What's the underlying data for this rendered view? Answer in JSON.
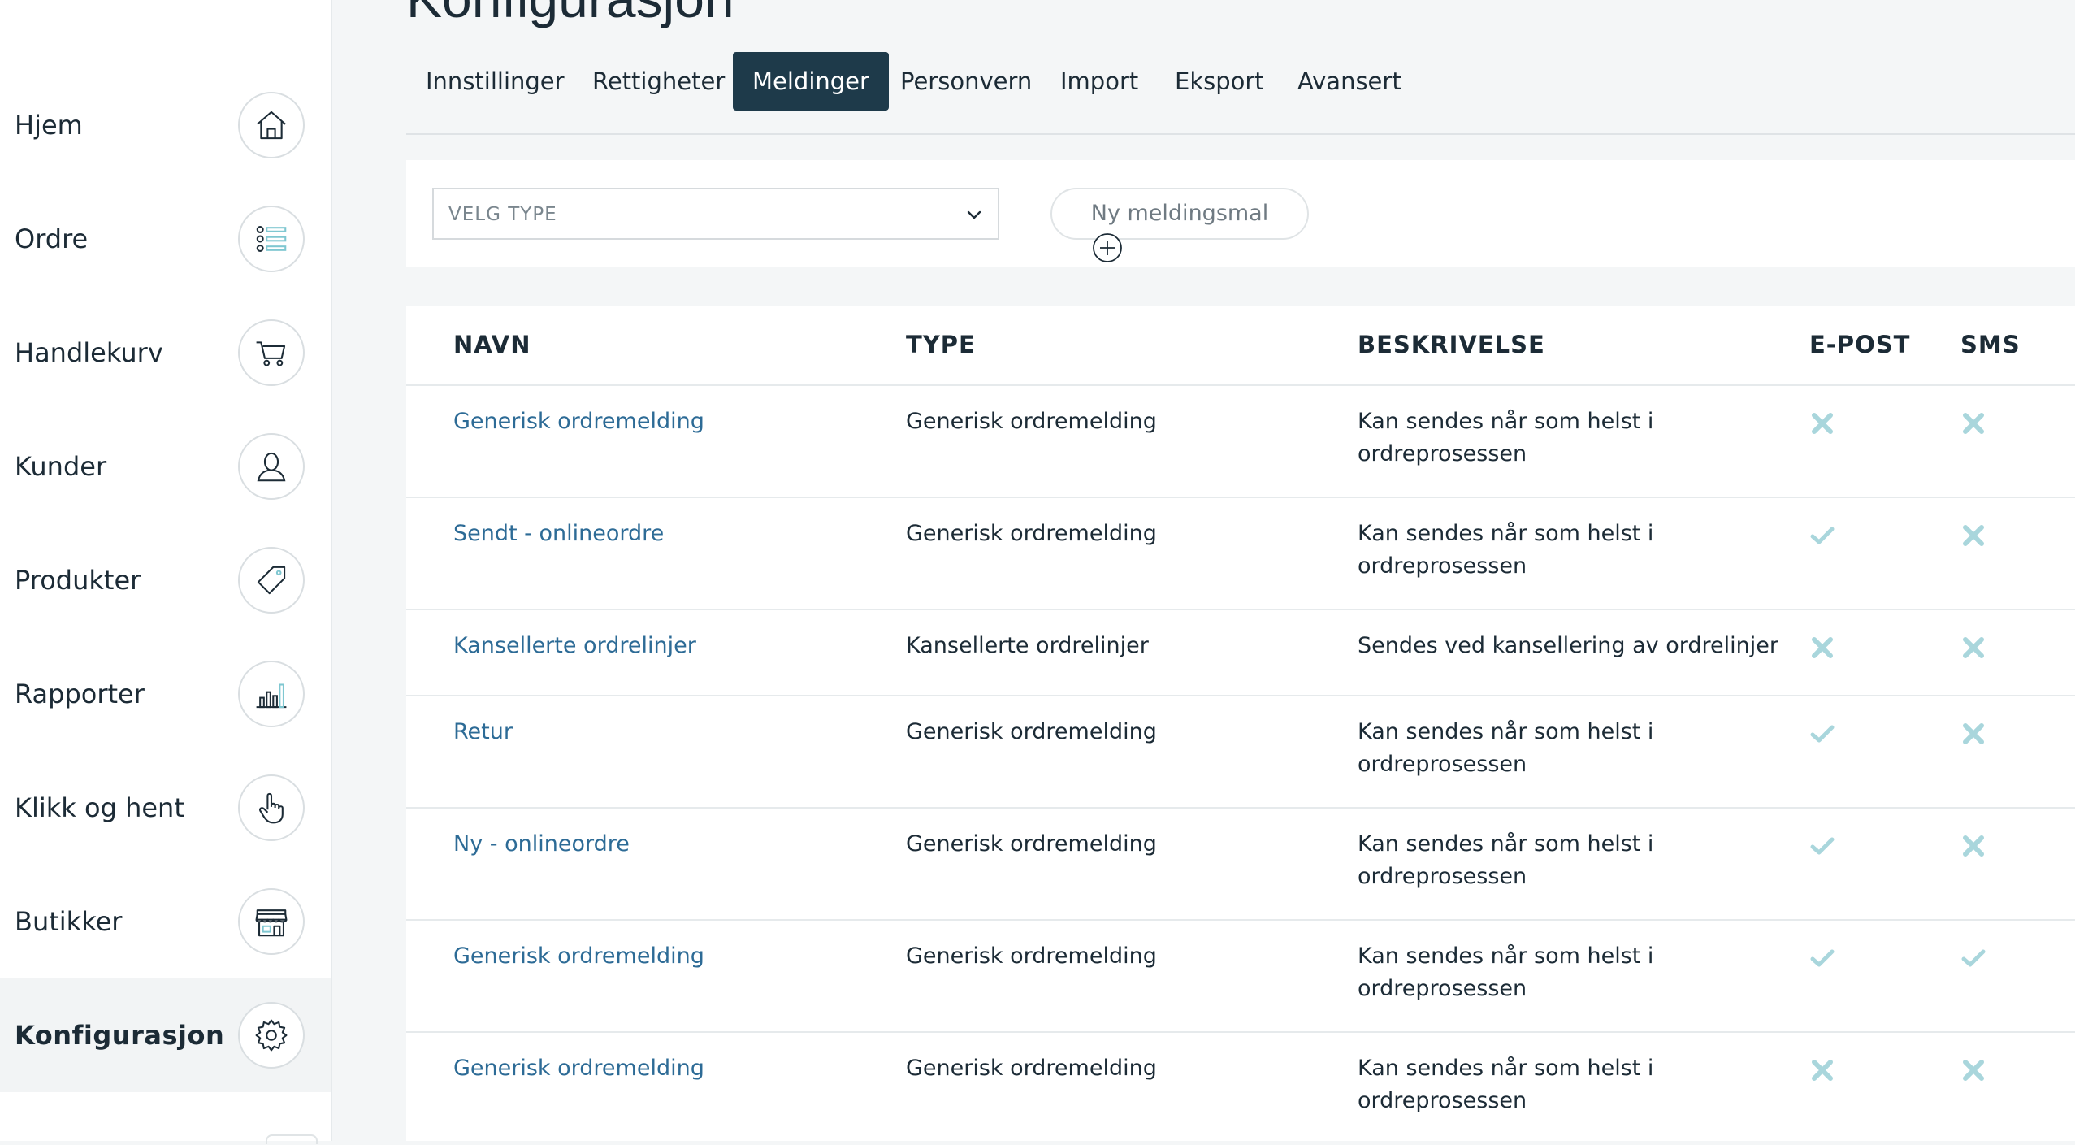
{
  "page": {
    "title": "Konfigurasjon"
  },
  "sidebar": {
    "items": [
      {
        "label": "Hjem",
        "icon": "home-icon"
      },
      {
        "label": "Ordre",
        "icon": "list-icon"
      },
      {
        "label": "Handlekurv",
        "icon": "cart-icon"
      },
      {
        "label": "Kunder",
        "icon": "user-icon"
      },
      {
        "label": "Produkter",
        "icon": "tag-icon"
      },
      {
        "label": "Rapporter",
        "icon": "bar-chart-icon"
      },
      {
        "label": "Klikk og hent",
        "icon": "hand-pointer-icon"
      },
      {
        "label": "Butikker",
        "icon": "store-icon"
      },
      {
        "label": "Konfigurasjon",
        "icon": "gear-icon",
        "active": true
      }
    ]
  },
  "tabs": {
    "items": [
      "Innstillinger",
      "Rettigheter",
      "Meldinger",
      "Personvern",
      "Import",
      "Eksport",
      "Avansert"
    ],
    "active": "Meldinger"
  },
  "filter": {
    "select_value": "VELG TYPE",
    "new_button_label": "Ny meldingsmal"
  },
  "table": {
    "headers": [
      "NAVN",
      "TYPE",
      "BESKRIVELSE",
      "E-POST",
      "SMS"
    ],
    "rows": [
      {
        "name": "Generisk ordremelding",
        "type": "Generisk ordremelding",
        "desc1": "Kan sendes når som helst i",
        "desc2": "ordreprosessen",
        "email": false,
        "sms": false
      },
      {
        "name": "Sendt - onlineordre",
        "type": "Generisk ordremelding",
        "desc1": "Kan sendes når som helst i",
        "desc2": "ordreprosessen",
        "email": true,
        "sms": false
      },
      {
        "name": "Kansellerte ordrelinjer",
        "type": "Kansellerte ordrelinjer",
        "desc1": "Sendes ved kansellering av ordrelinjer",
        "desc2": "",
        "email": false,
        "sms": false
      },
      {
        "name": "Retur",
        "type": "Generisk ordremelding",
        "desc1": "Kan sendes når som helst i",
        "desc2": "ordreprosessen",
        "email": true,
        "sms": false
      },
      {
        "name": "Ny - onlineordre",
        "type": "Generisk ordremelding",
        "desc1": "Kan sendes når som helst i",
        "desc2": "ordreprosessen",
        "email": true,
        "sms": false
      },
      {
        "name": "Generisk ordremelding",
        "type": "Generisk ordremelding",
        "desc1": "Kan sendes når som helst i",
        "desc2": "ordreprosessen",
        "email": true,
        "sms": true
      },
      {
        "name": "Generisk ordremelding",
        "type": "Generisk ordremelding",
        "desc1": "Kan sendes når som helst i",
        "desc2": "ordreprosessen",
        "email": false,
        "sms": false
      }
    ]
  },
  "colors": {
    "accent_dark": "#1e3a4a",
    "link": "#2d6b96",
    "status_mark": "#a9d6dc",
    "icon_accent": "#7fc7d1"
  }
}
